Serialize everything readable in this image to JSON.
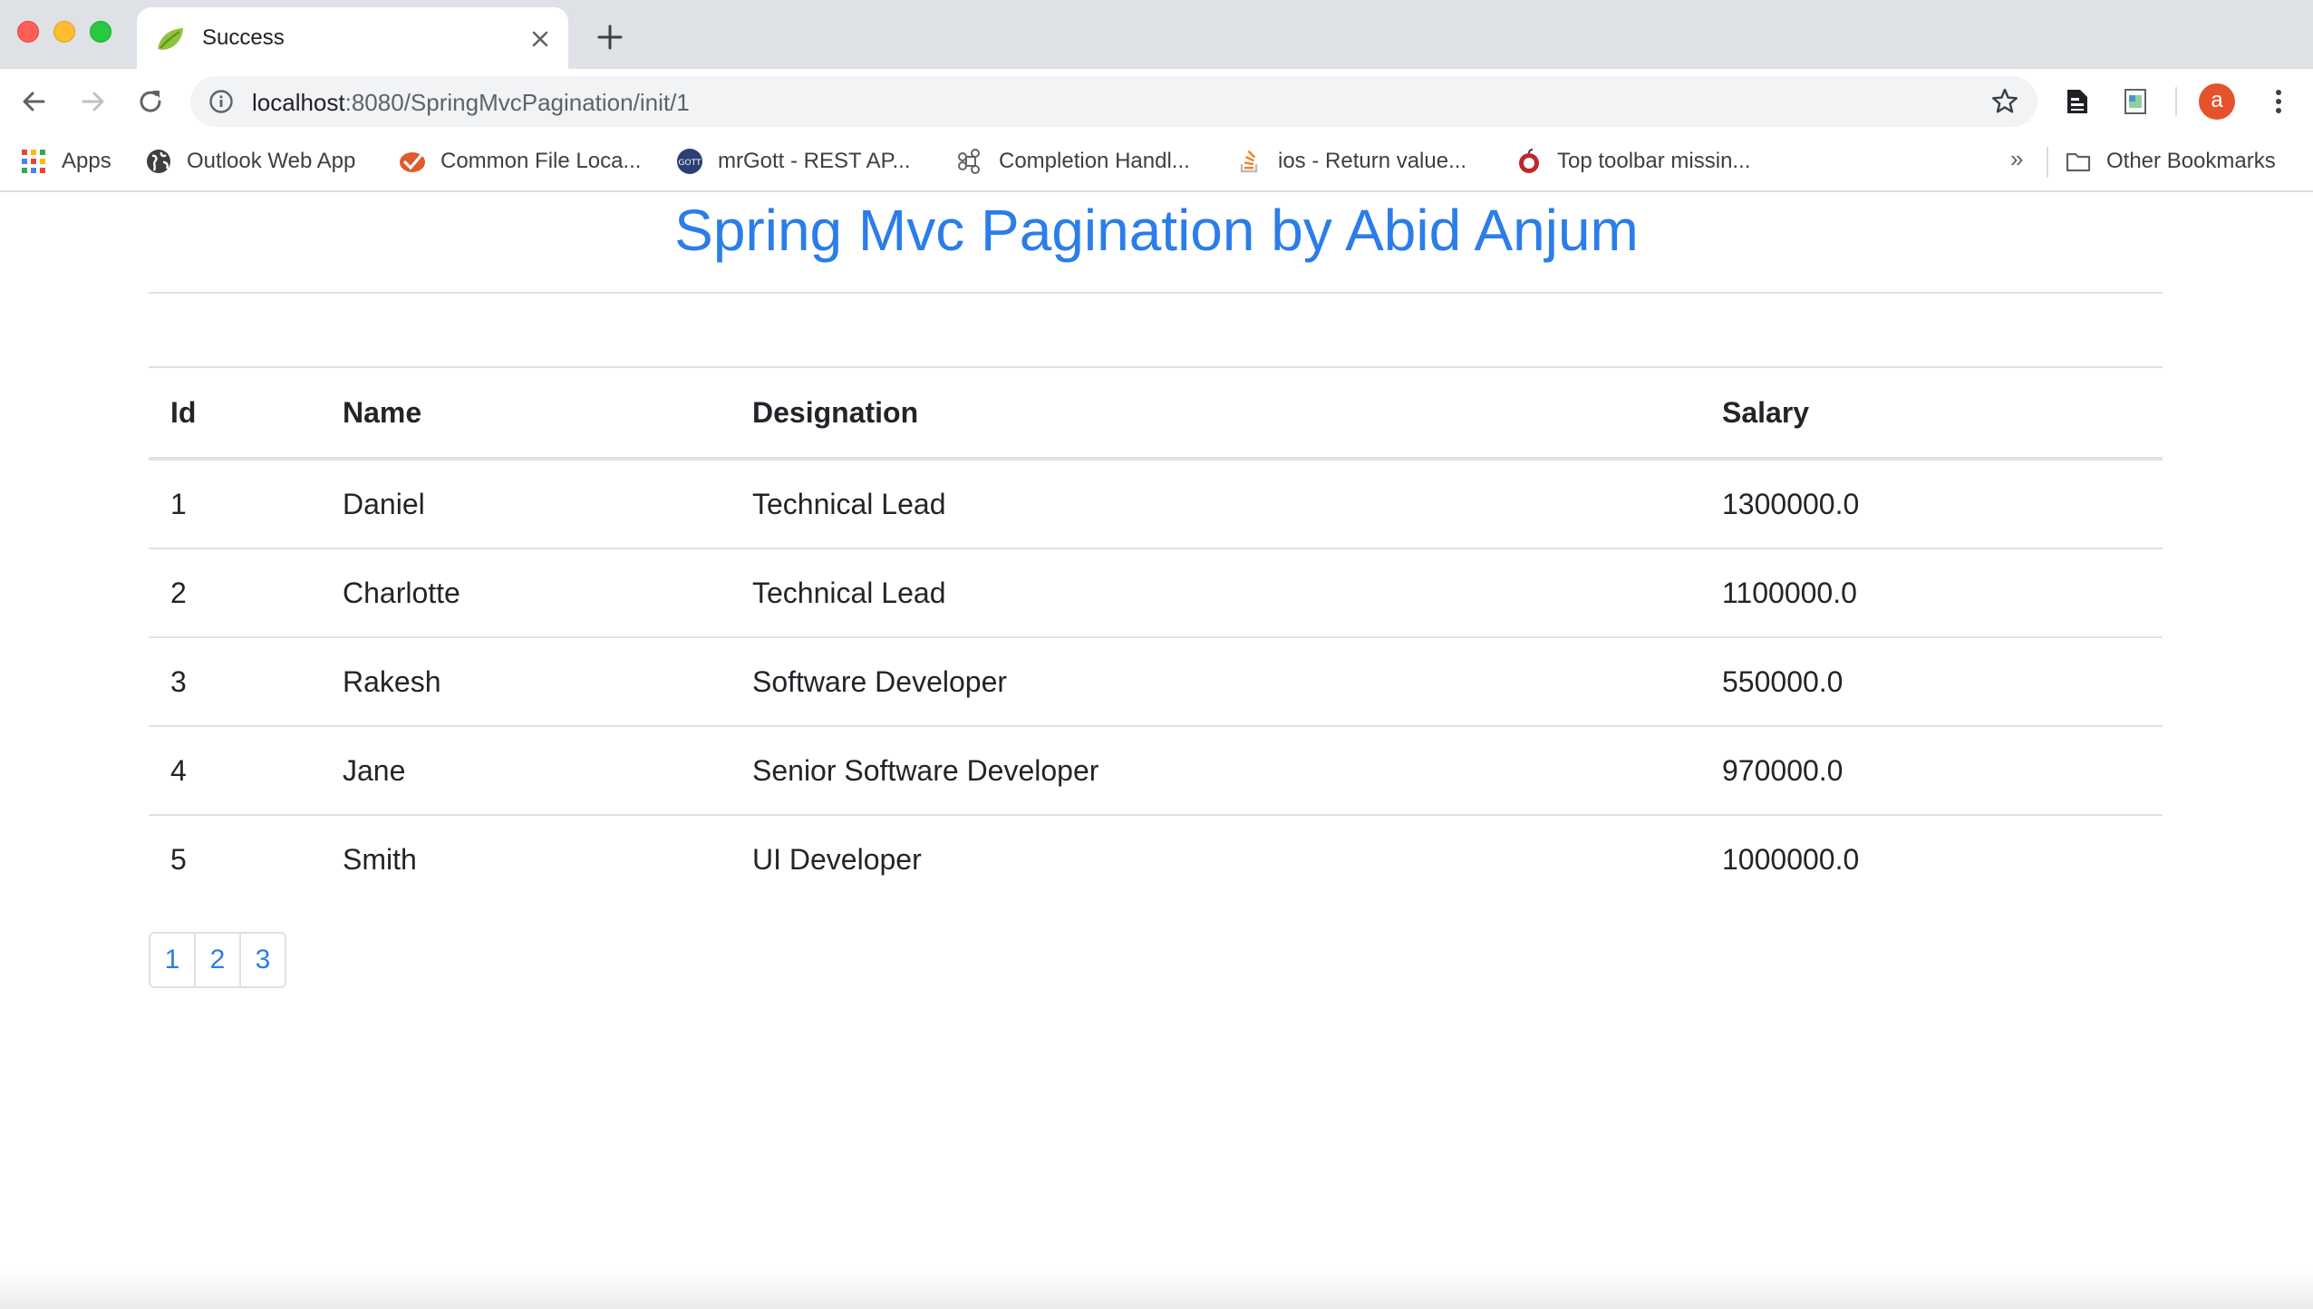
{
  "browser": {
    "tab_title": "Success",
    "url_host": "localhost",
    "url_path": ":8080/SpringMvcPagination/init/1",
    "avatar_letter": "a",
    "bookmarks": [
      {
        "label": "Apps",
        "icon": "apps-grid-icon"
      },
      {
        "label": "Outlook Web App",
        "icon": "globe-icon"
      },
      {
        "label": "Common File Loca...",
        "icon": "checkmark-badge-icon"
      },
      {
        "label": "mrGott - REST AP...",
        "icon": "gott-logo-icon"
      },
      {
        "label": "Completion Handl...",
        "icon": "command-key-icon"
      },
      {
        "label": "ios - Return value...",
        "icon": "stackoverflow-icon"
      },
      {
        "label": "Top toolbar missin...",
        "icon": "apple-dev-icon"
      }
    ],
    "more_bookmarks": "»",
    "other_bookmarks": "Other Bookmarks"
  },
  "page": {
    "title": "Spring Mvc Pagination by Abid Anjum",
    "table": {
      "headers": [
        "Id",
        "Name",
        "Designation",
        "Salary"
      ],
      "rows": [
        [
          "1",
          "Daniel",
          "Technical Lead",
          "1300000.0"
        ],
        [
          "2",
          "Charlotte",
          "Technical Lead",
          "1100000.0"
        ],
        [
          "3",
          "Rakesh",
          "Software Developer",
          "550000.0"
        ],
        [
          "4",
          "Jane",
          "Senior Software Developer",
          "970000.0"
        ],
        [
          "5",
          "Smith",
          "UI Developer",
          "1000000.0"
        ]
      ]
    },
    "pagination": [
      "1",
      "2",
      "3"
    ]
  },
  "colors": {
    "accent": "#2b7de9",
    "avatar": "#e5532d"
  }
}
